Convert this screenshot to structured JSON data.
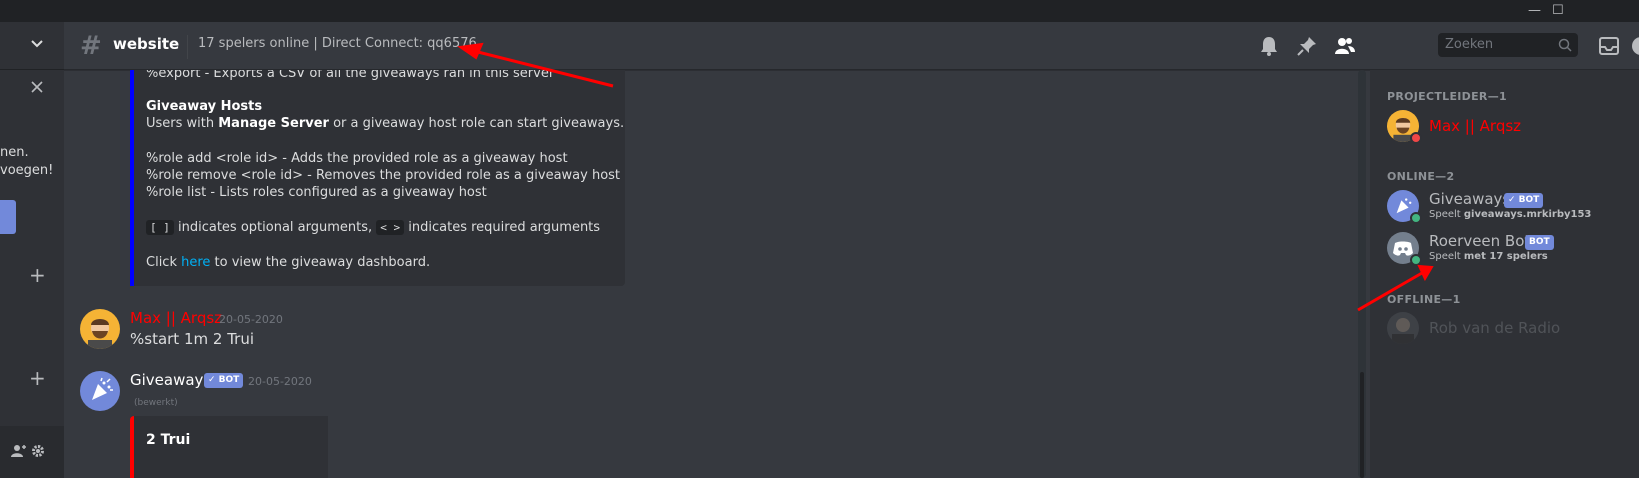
{
  "header": {
    "channel_name": "website",
    "topic": "17 spelers online | Direct Connect: qq6576",
    "search_placeholder": "Zoeken"
  },
  "sidebar": {
    "text_line1": "nen.",
    "text_line2": "voegen!"
  },
  "embed": {
    "export_line": "%export - Exports a CSV of all the giveaways ran in this server",
    "hosts_title": "Giveaway Hosts",
    "hosts_prefix": "Users with ",
    "hosts_bold": "Manage Server",
    "hosts_suffix": " or a giveaway host role can start giveaways.",
    "role_add": "%role add <role id> - Adds the provided role as a giveaway host",
    "role_remove": "%role remove <role id> - Removes the provided role as a giveaway host",
    "role_list": "%role list - Lists roles configured as a giveaway host",
    "optional_code": "[ ]",
    "optional_text": " indicates optional arguments, ",
    "required_code": "< >",
    "required_text": " indicates required arguments",
    "click_prefix": "Click ",
    "click_link": "here",
    "click_suffix": " to view the giveaway dashboard."
  },
  "messages": [
    {
      "author": "Max || Arqsz",
      "author_color": "#ff0000",
      "timestamp": "20-05-2020",
      "text": "%start 1m 2 Trui"
    },
    {
      "author": "Giveaways",
      "author_color": "#ffffff",
      "bot_tag": "✓ BOT",
      "timestamp": "20-05-2020",
      "edited": "(bewerkt)",
      "embed_title": "2 Trui"
    }
  ],
  "members": {
    "groups": [
      {
        "title": "PROJECTLEIDER—1",
        "members": [
          {
            "name": "Max || Arqsz",
            "name_color": "#ff0000",
            "status": "dnd"
          }
        ]
      },
      {
        "title": "ONLINE—2",
        "members": [
          {
            "name": "Giveaways",
            "bot_tag": "✓ BOT",
            "activity_prefix": "Speelt ",
            "activity_bold": "giveaways.mrkirby153",
            "status": "online"
          },
          {
            "name": "Roerveen Bot",
            "bot_tag": "BOT",
            "activity_prefix": "Speelt ",
            "activity_bold": "met 17 spelers",
            "status": "online"
          }
        ]
      },
      {
        "title": "OFFLINE—1",
        "members": [
          {
            "name": "Rob van de Radio",
            "status": "offline"
          }
        ]
      }
    ]
  },
  "colors": {
    "accent": "#7289da",
    "online": "#43b581",
    "dnd": "#f04747",
    "annotation_arrow": "#ff0000"
  }
}
